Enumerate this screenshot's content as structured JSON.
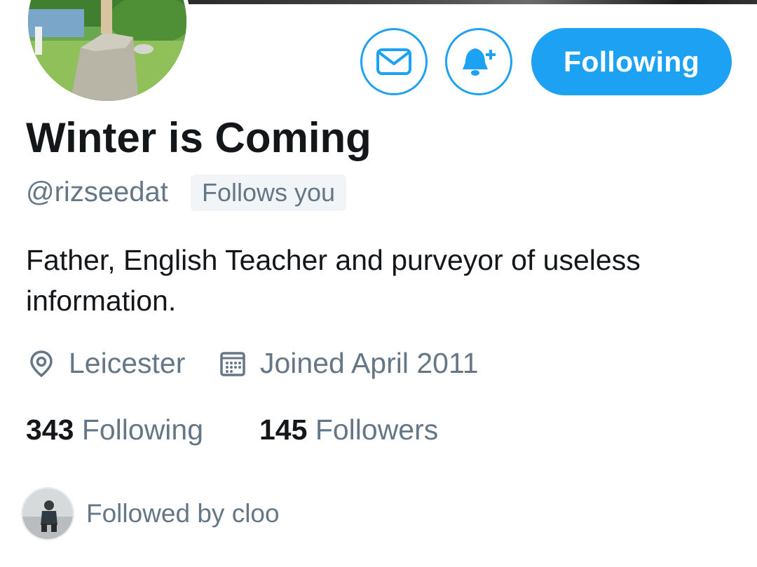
{
  "profile": {
    "name": "Winter is Coming",
    "handle": "@rizseedat",
    "follows_you_badge": "Follows you",
    "bio": "Father, English Teacher and purveyor of useless information.",
    "location": "Leicester",
    "joined": "Joined April 2011",
    "avatar_icon": "profile-photo-standing-stone"
  },
  "actions": {
    "message_icon": "envelope-icon",
    "notify_icon": "bell-plus-icon",
    "follow_label": "Following"
  },
  "stats": {
    "following_count": "343",
    "following_label": "Following",
    "followers_count": "145",
    "followers_label": "Followers"
  },
  "followed_by": {
    "text": "Followed by cloo"
  },
  "colors": {
    "accent": "#1da1f2",
    "text_primary": "#14171a",
    "text_secondary": "#657786",
    "badge_bg": "#f2f5f7"
  }
}
